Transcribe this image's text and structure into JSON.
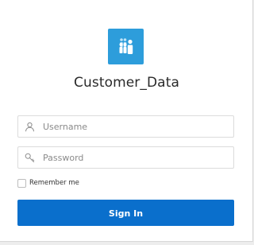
{
  "app": {
    "title": "Customer_Data",
    "logo_icon": "people-group-icon",
    "logo_color": "#2d9ddb"
  },
  "form": {
    "username": {
      "placeholder": "Username",
      "value": "",
      "icon": "user-icon"
    },
    "password": {
      "placeholder": "Password",
      "value": "",
      "icon": "key-icon"
    },
    "remember_label": "Remember me",
    "remember_checked": false,
    "submit_label": "Sign In",
    "submit_color": "#0a6fcc"
  }
}
